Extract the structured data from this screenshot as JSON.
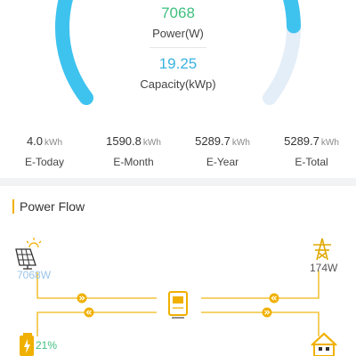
{
  "gauge": {
    "power_value": "7068",
    "power_label": "Power(W)",
    "capacity_value": "19.25",
    "capacity_label": "Capacity(kWp)",
    "fill_fraction": 0.85,
    "colors": {
      "arc": "#3ec3ef",
      "track": "#e4eef8"
    }
  },
  "stats": [
    {
      "value": "4.0",
      "unit": "kWh",
      "label": "E-Today"
    },
    {
      "value": "1590.8",
      "unit": "kWh",
      "label": "E-Month"
    },
    {
      "value": "5289.7",
      "unit": "kWh",
      "label": "E-Year"
    },
    {
      "value": "5289.7",
      "unit": "kWh",
      "label": "E-Total"
    }
  ],
  "power_flow": {
    "title": "Power Flow",
    "solar_value": "7068W",
    "grid_value": "174W",
    "battery_value": "21%",
    "icons": [
      "solar-panel-icon",
      "grid-tower-icon",
      "inverter-icon",
      "battery-icon",
      "home-icon"
    ],
    "colors": {
      "flow_line": "#f2c33c",
      "accent": "#f0b000"
    }
  }
}
